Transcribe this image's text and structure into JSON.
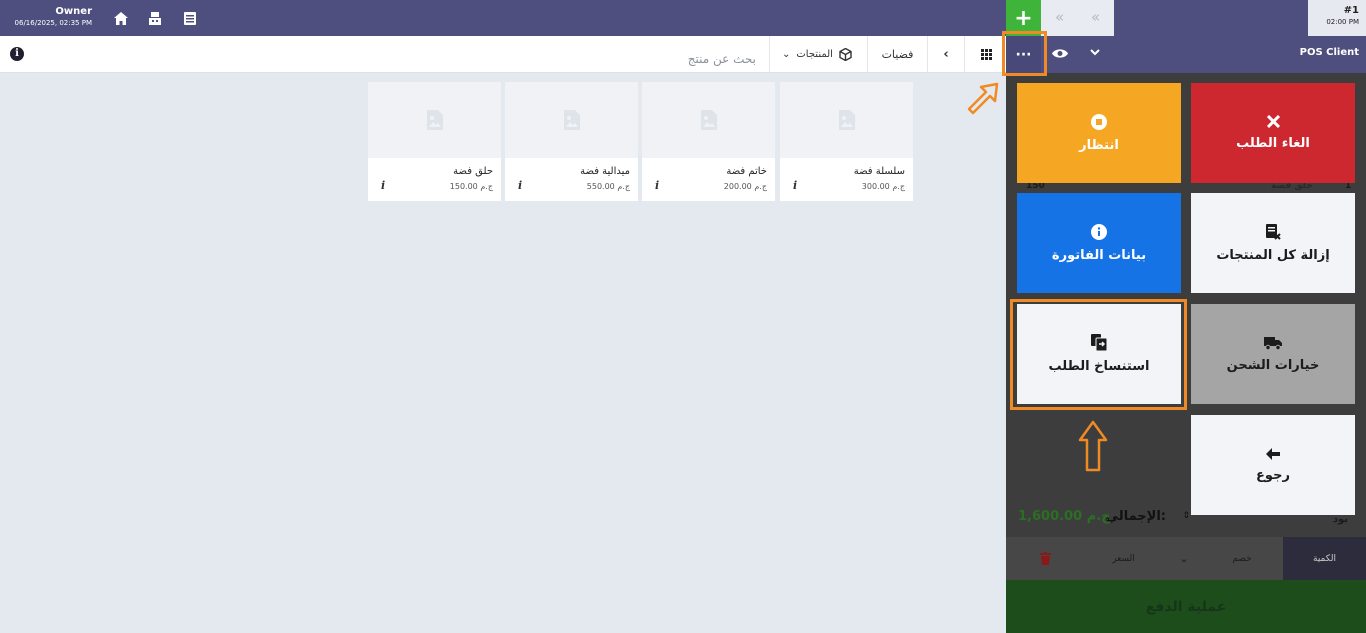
{
  "topbar": {
    "owner_name": "Owner",
    "owner_datetime": "06/16/2025, 02:35 PM",
    "add_tab_label": "+",
    "order_number": "#1",
    "order_time": "02:00 PM"
  },
  "toolbar": {
    "search_placeholder": "بحث عن منتج",
    "products_label": "المنتجات",
    "category_label": "فضيات"
  },
  "products": [
    {
      "name": "سلسلة فضة",
      "price": "300.00 ج.م"
    },
    {
      "name": "خاتم فضة",
      "price": "200.00 ج.م"
    },
    {
      "name": "ميدالية فضة",
      "price": "550.00 ج.م"
    },
    {
      "name": "حلق فضة",
      "price": "150.00 ج.م"
    }
  ],
  "panel": {
    "client_label": "POS Client",
    "dots_label": "···",
    "background_item_name": "حلق فضة",
    "background_item_qty": "1",
    "background_item_price": "150",
    "total_label": "الإجمالي:",
    "total_value": "1,600.00 ج.م",
    "total_prefix": "بود",
    "tab_qty": "الكمية",
    "tab_discount": "خصم",
    "tab_price": "السعر",
    "pay_label": "عملية الدفع"
  },
  "actions": {
    "cancel": "الغاء الطلب",
    "wait": "انتظار",
    "remove_all": "إزالة كل المنتجات",
    "invoice": "بيانات الفاتورة",
    "shipping": "خيارات الشحن",
    "copy": "استنساخ الطلب",
    "back": "رجوع"
  },
  "colors": {
    "topbar": "#4f4f7f",
    "add_tab": "#3eb53a",
    "cancel": "#cd2730",
    "wait": "#f5a623",
    "invoice": "#1673e6",
    "shipping": "#a5a5a5",
    "highlight": "#f08a24"
  },
  "icons": [
    "home-icon",
    "cash-register-icon",
    "receipt-icon",
    "info-icon",
    "grid-icon",
    "box-icon",
    "chevron-down-icon",
    "eye-icon",
    "close-icon",
    "pause-circle-icon",
    "remove-list-icon",
    "info-circle-icon",
    "truck-icon",
    "copy-icon",
    "arrow-left-icon",
    "trash-icon",
    "image-placeholder-icon"
  ]
}
